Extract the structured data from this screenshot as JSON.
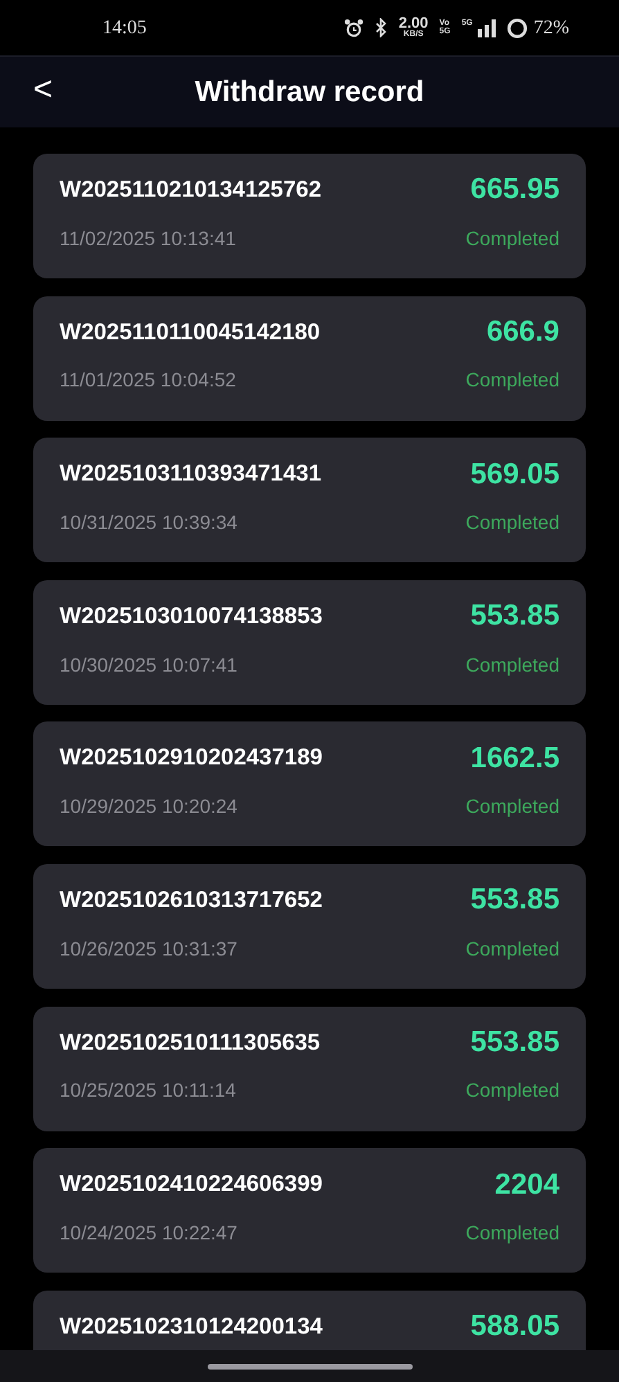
{
  "status_bar": {
    "time": "14:05",
    "speed": "2.00",
    "speed_unit": "KB/S",
    "volte_top": "Vo",
    "volte_bottom": "5G",
    "network": "5G",
    "battery": "72%"
  },
  "header": {
    "back": "<",
    "title": "Withdraw record"
  },
  "records": [
    {
      "id": "W2025110210134125762",
      "amount": "665.95",
      "date": "11/02/2025 10:13:41",
      "status": "Completed"
    },
    {
      "id": "W2025110110045142180",
      "amount": "666.9",
      "date": "11/01/2025 10:04:52",
      "status": "Completed"
    },
    {
      "id": "W2025103110393471431",
      "amount": "569.05",
      "date": "10/31/2025 10:39:34",
      "status": "Completed"
    },
    {
      "id": "W2025103010074138853",
      "amount": "553.85",
      "date": "10/30/2025 10:07:41",
      "status": "Completed"
    },
    {
      "id": "W2025102910202437189",
      "amount": "1662.5",
      "date": "10/29/2025 10:20:24",
      "status": "Completed"
    },
    {
      "id": "W2025102610313717652",
      "amount": "553.85",
      "date": "10/26/2025 10:31:37",
      "status": "Completed"
    },
    {
      "id": "W2025102510111305635",
      "amount": "553.85",
      "date": "10/25/2025 10:11:14",
      "status": "Completed"
    },
    {
      "id": "W2025102410224606399",
      "amount": "2204",
      "date": "10/24/2025 10:22:47",
      "status": "Completed"
    },
    {
      "id": "W2025102310124200134",
      "amount": "588.05"
    }
  ]
}
